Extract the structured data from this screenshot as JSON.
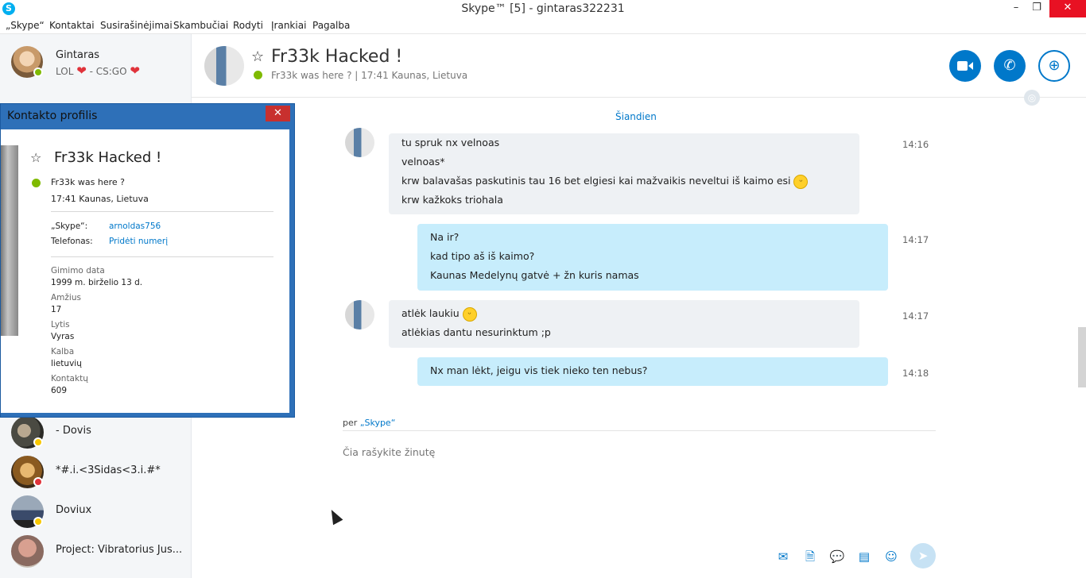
{
  "window": {
    "title": "Skype™ [5] - gintaras322231",
    "app_icon_letter": "S",
    "minimize": "–",
    "restore": "❐",
    "close": "✕"
  },
  "menu": [
    "„Skype“",
    "Kontaktai",
    "Susirašinėjimai",
    "Skambučiai",
    "Rodyti",
    "Įrankiai",
    "Pagalba"
  ],
  "me": {
    "name": "Gintaras",
    "mood": "LOL",
    "mood_mid": " - CS:GO",
    "heart": "❤"
  },
  "contacts": [
    {
      "name": "- Dovis",
      "status": "away"
    },
    {
      "name": "*#.i.<3Sidas<3.i.#*",
      "status": "dnd"
    },
    {
      "name": "Doviux",
      "status": "away"
    },
    {
      "name": "Project: Vibratorius Jus...",
      "status": "none"
    }
  ],
  "conversation": {
    "name": "Fr33k Hacked !",
    "mood": "Fr33k was here ?  |  17:41 Kaunas, Lietuva",
    "today": "Šiandien"
  },
  "header_buttons": {
    "video": "video-call",
    "call": "voice-call",
    "add": "add-people"
  },
  "messages": [
    {
      "direction": "in",
      "time": "14:16",
      "lines": [
        "tu spruk nx velnoas",
        "velnoas*",
        "krw balavašas paskutinis tau 16 bet elgiesi kai mažvaikis neveltui iš kaimo esi",
        "krw kažkoks triohala"
      ]
    },
    {
      "direction": "out",
      "time": "14:17",
      "lines": [
        "Na ir?",
        "kad tipo aš iš kaimo?",
        "Kaunas Medelynų gatvė + žn kuris namas"
      ]
    },
    {
      "direction": "in",
      "time": "14:17",
      "lines": [
        "atlėk laukiu",
        "atlėkias dantu nesurinktum ;p"
      ]
    },
    {
      "direction": "out",
      "time": "14:18",
      "lines": [
        "Nx man lėkt, jeigu vis tiek nieko ten nebus?"
      ]
    }
  ],
  "composer": {
    "via_prefix": "per",
    "via_link": "„Skype“",
    "placeholder": "Čia rašykite žinutę"
  },
  "profile": {
    "title": "Kontakto profilis",
    "close": "✕",
    "name": "Fr33k Hacked !",
    "mood": "Fr33k was here ?",
    "location": "17:41 Kaunas, Lietuva",
    "skype_label": "„Skype“:",
    "skype_value": "arnoldas756",
    "phone_label": "Telefonas:",
    "phone_value": "Pridėti numerį",
    "birth_label": "Gimimo data",
    "birth_value": "1999 m. birželio 13 d.",
    "age_label": "Amžius",
    "age_value": "17",
    "gender_label": "Lytis",
    "gender_value": "Vyras",
    "language_label": "Kalba",
    "language_value": "lietuvių",
    "contacts_label": "Kontaktų",
    "contacts_value": "609"
  },
  "colors": {
    "accent": "#0078ca",
    "incoming_bubble": "#eef1f4",
    "outgoing_bubble": "#c7edfc",
    "online": "#7fba00",
    "away": "#f8c800",
    "dnd": "#e0333b",
    "profile_frame": "#2e70b8"
  }
}
